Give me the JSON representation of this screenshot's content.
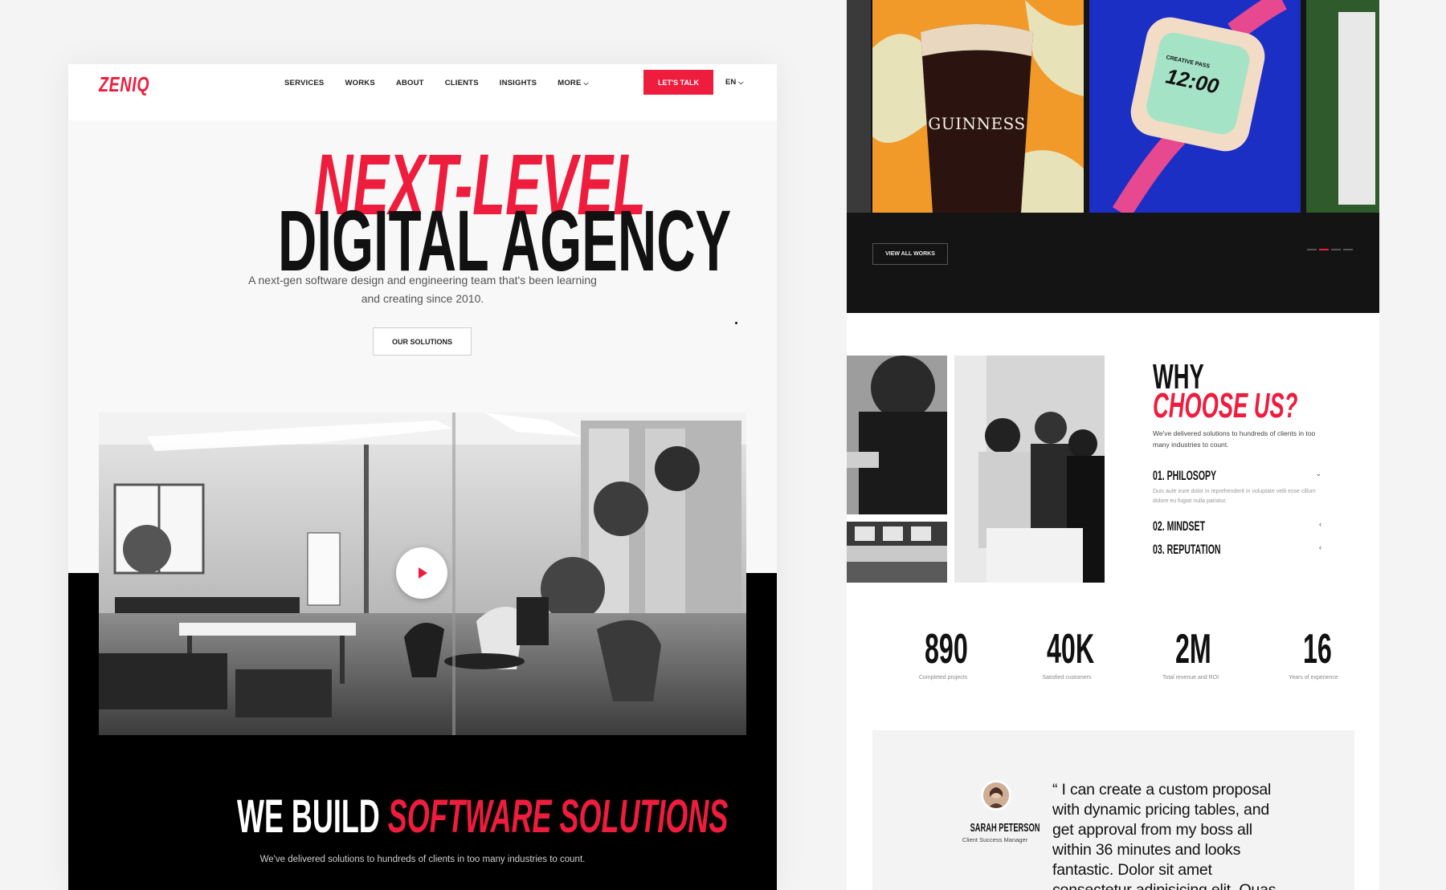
{
  "left": {
    "logo": "ZENIQ",
    "nav": [
      "SERVICES",
      "WORKS",
      "ABOUT",
      "CLIENTS",
      "INSIGHTS",
      "MORE"
    ],
    "cta": "LET'S TALK",
    "lang": "EN",
    "hero_line1": "NEXT-LEVEL",
    "hero_line2": "DIGITAL AGENCY",
    "hero_sub": "A next-gen software design and engineering team that's been learning and creating since 2010.",
    "solutions_btn": "OUR SOLUTIONS",
    "build_title_white": "WE BUILD ",
    "build_title_red": "SOFTWARE SOLUTIONS",
    "build_sub": "We've delivered solutions to hundreds of clients in too many industries to count."
  },
  "right": {
    "works_tiles": {
      "guinness_text": "GUINNESS",
      "watch_time": "12:00",
      "watch_label": "CREATIVE PASS"
    },
    "view_all_btn": "VIEW ALL WORKS",
    "why_line1": "WHY",
    "why_line2": "CHOOSE US?",
    "why_sub": "We've delivered solutions to hundreds of clients in too many industries to count.",
    "accordion": [
      {
        "title": "01. PHILOSOPY",
        "body": "Duis aute irure dolor in reprehenderit in voluptate velit esse cillum dolore eu fugiat nulla pariatur.",
        "open": true
      },
      {
        "title": "02. MINDSET",
        "open": false
      },
      {
        "title": "03. REPUTATION",
        "open": false
      }
    ],
    "stats": [
      {
        "value": "890",
        "label": "Completed projects"
      },
      {
        "value": "40K",
        "label": "Satisfied customers"
      },
      {
        "value": "2M",
        "label": "Total revenue and ROI"
      },
      {
        "value": "16",
        "label": "Years of experience"
      }
    ],
    "testimonial": {
      "name": "SARAH PETERSON",
      "role": "Client Success Manager",
      "quote": "“ I can create a custom proposal with dynamic pricing tables, and get approval from my boss all within 36 minutes and looks fantastic. Dolor sit amet consectetur adipisicing elit. Quas"
    }
  },
  "colors": {
    "accent": "#ee1c3d",
    "dark": "#141414",
    "page_bg": "#f4f4f4"
  }
}
